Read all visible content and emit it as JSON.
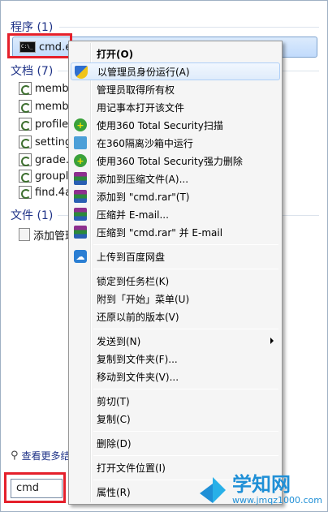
{
  "results": {
    "programs_header": "程序 (1)",
    "program": "cmd.ex",
    "documents_header": "文档 (7)",
    "documents": [
      "membe",
      "membe",
      "profile.",
      "setting",
      "grade.",
      "groupl",
      "find.4a"
    ],
    "files_header": "文件 (1)",
    "file": "添加管理",
    "see_more": "查看更多结",
    "search_value": "cmd"
  },
  "menu": {
    "open": "打开(O)",
    "run_as_admin": "以管理员身份运行(A)",
    "take_ownership": "管理员取得所有权",
    "open_notepad": "用记事本打开该文件",
    "scan_360": "使用360 Total Security扫描",
    "sandbox_360": "在360隔离沙箱中运行",
    "force_delete_360": "使用360 Total Security强力删除",
    "add_archive": "添加到压缩文件(A)...",
    "add_cmd_rar": "添加到 \"cmd.rar\"(T)",
    "compress_email": "压缩并 E-mail...",
    "compress_cmd_rar_email": "压缩到 \"cmd.rar\" 并 E-mail",
    "upload_baidu": "上传到百度网盘",
    "pin_taskbar": "锁定到任务栏(K)",
    "pin_start": "附到「开始」菜单(U)",
    "restore_versions": "还原以前的版本(V)",
    "send_to": "发送到(N)",
    "copy_to_folder": "复制到文件夹(F)...",
    "move_to_folder": "移动到文件夹(V)...",
    "cut": "剪切(T)",
    "copy": "复制(C)",
    "delete": "删除(D)",
    "open_location": "打开文件位置(I)",
    "properties": "属性(R)"
  },
  "watermark": {
    "title": "学知网",
    "url": "www.jmqz1000.com"
  },
  "colors": {
    "highlight": "#e5202b",
    "group_title": "#1e3287"
  }
}
